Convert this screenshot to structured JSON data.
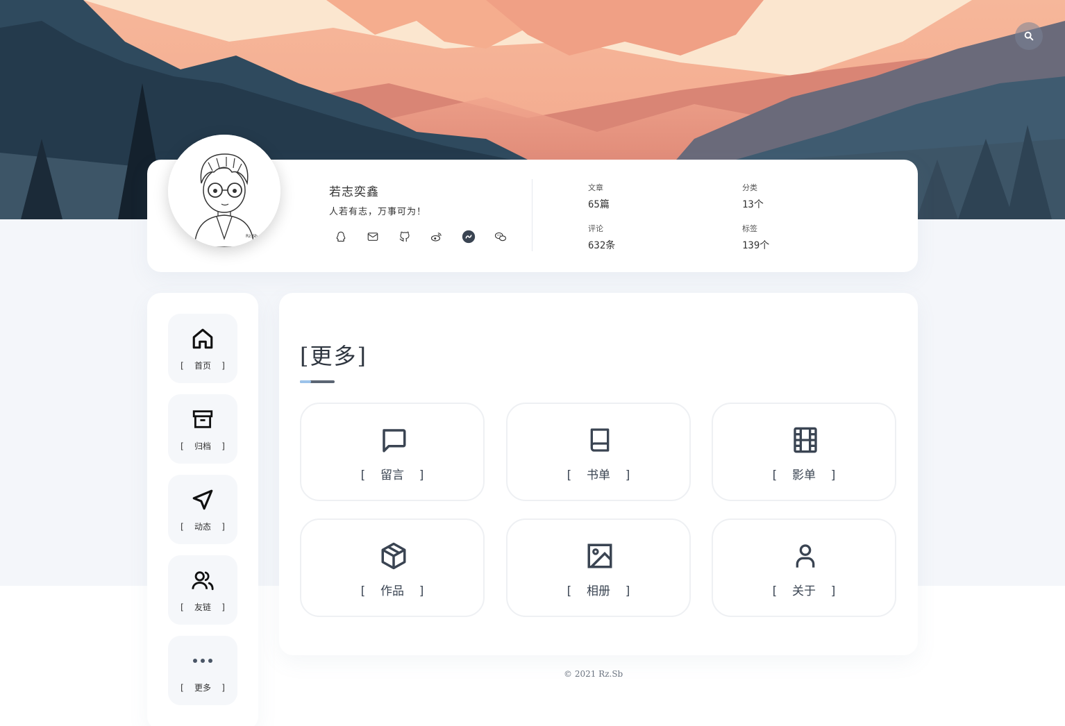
{
  "header": {
    "search_icon": "search-icon"
  },
  "profile": {
    "name": "若志奕鑫",
    "motto": "人若有志，万事可为！",
    "socials": [
      {
        "icon": "qq-icon"
      },
      {
        "icon": "mail-icon"
      },
      {
        "icon": "github-icon"
      },
      {
        "icon": "weibo-icon"
      },
      {
        "icon": "bilibili-icon"
      },
      {
        "icon": "wechat-icon"
      }
    ],
    "stats": {
      "articles": {
        "label": "文章",
        "value": "65篇"
      },
      "categories": {
        "label": "分类",
        "value": "13个"
      },
      "comments": {
        "label": "评论",
        "value": "632条"
      },
      "tags": {
        "label": "标签",
        "value": "139个"
      }
    }
  },
  "sidebar": {
    "items": [
      {
        "label": "[  首页  ]",
        "icon": "home-icon"
      },
      {
        "label": "[  归档  ]",
        "icon": "archive-icon"
      },
      {
        "label": "[  动态  ]",
        "icon": "navigation-icon"
      },
      {
        "label": "[  友链  ]",
        "icon": "users-icon"
      },
      {
        "label": "[  更多  ]",
        "icon": "more-icon"
      }
    ]
  },
  "main": {
    "title": "[更多]",
    "tiles": [
      {
        "label": "[  留言  ]",
        "icon": "message-icon"
      },
      {
        "label": "[  书单  ]",
        "icon": "book-icon"
      },
      {
        "label": "[  影单  ]",
        "icon": "film-icon"
      },
      {
        "label": "[  作品  ]",
        "icon": "box-icon"
      },
      {
        "label": "[  相册  ]",
        "icon": "image-icon"
      },
      {
        "label": "[  关于  ]",
        "icon": "user-icon"
      }
    ]
  },
  "footer": {
    "copyright": "© 2021 Rz.Sb"
  },
  "colors": {
    "page_bg": "#f4f6fa",
    "card_bg": "#ffffff",
    "icon_dark": "#3a4452",
    "accent": "#9cc3ea"
  }
}
